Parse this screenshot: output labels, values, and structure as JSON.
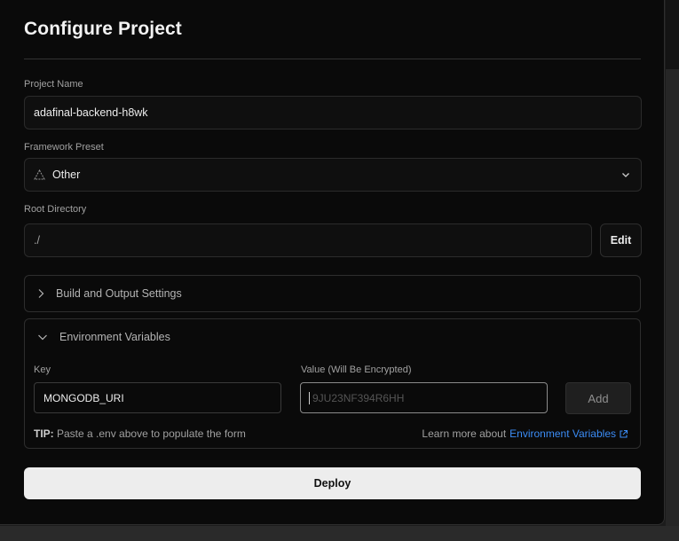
{
  "title": "Configure Project",
  "project_name": {
    "label": "Project Name",
    "value": "adafinal-backend-h8wk"
  },
  "framework_preset": {
    "label": "Framework Preset",
    "value": "Other",
    "icon": "warning-triangle-icon"
  },
  "root_directory": {
    "label": "Root Directory",
    "value": "./",
    "edit_label": "Edit"
  },
  "build_settings": {
    "label": "Build and Output Settings",
    "expanded": false
  },
  "env_vars": {
    "label": "Environment Variables",
    "expanded": true,
    "key_label": "Key",
    "value_label": "Value (Will Be Encrypted)",
    "key_value": "MONGODB_URI",
    "value_placeholder": "9JU23NF394R6HH",
    "add_label": "Add",
    "tip_prefix": "TIP:",
    "tip_text": " Paste a .env above to populate the form",
    "learn_text": "Learn more about",
    "learn_link": "Environment Variables"
  },
  "deploy_label": "Deploy",
  "colors": {
    "link": "#3b8cf5",
    "deploy_bg": "#ededed",
    "background": "#0a0a0a"
  }
}
